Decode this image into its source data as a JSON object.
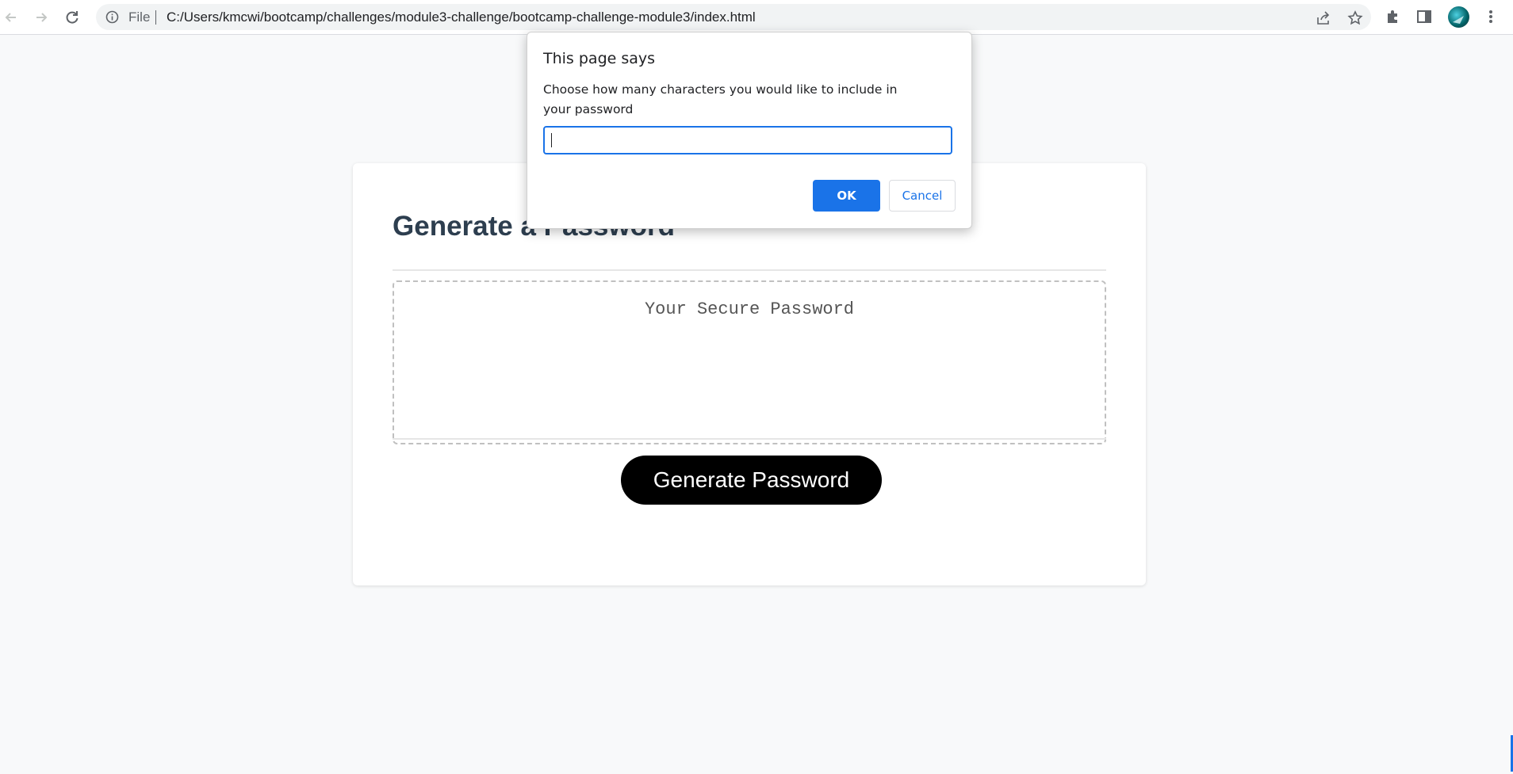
{
  "browser": {
    "protocol_label": "File",
    "url": "C:/Users/kmcwi/bootcamp/challenges/module3-challenge/bootcamp-challenge-module3/index.html",
    "icons": [
      "back-arrow-icon",
      "forward-arrow-icon",
      "reload-icon",
      "info-icon",
      "share-icon",
      "star-icon",
      "extensions-puzzle-icon",
      "side-panel-icon",
      "profile-avatar",
      "more-vert-icon"
    ]
  },
  "page": {
    "title": "Generate a Password",
    "password_placeholder": "Your Secure Password",
    "generate_button_label": "Generate Password"
  },
  "dialog": {
    "title": "This page says",
    "message": "Choose how many characters you would like to include in your password",
    "input_value": "",
    "ok_label": "OK",
    "cancel_label": "Cancel"
  },
  "colors": {
    "accent": "#1a73e8",
    "title_text": "#2d3e4f",
    "button_bg": "#000000"
  }
}
